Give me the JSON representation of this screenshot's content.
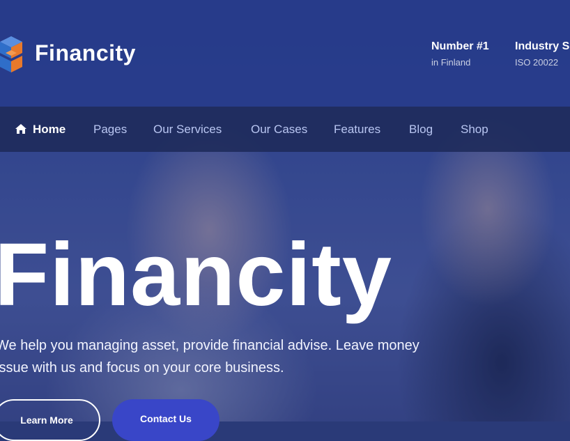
{
  "brand": {
    "name": "Financity",
    "icon": "cube-logo-icon",
    "accent_blue": "#2f6ec9",
    "accent_orange": "#e8792b"
  },
  "header": {
    "info": [
      {
        "title": "Number #1",
        "subtitle": "in Finland"
      },
      {
        "title": "Industry S",
        "subtitle": "ISO 20022"
      }
    ]
  },
  "nav": {
    "items": [
      {
        "label": "Home",
        "icon": "home-icon",
        "active": true
      },
      {
        "label": "Pages"
      },
      {
        "label": "Our Services"
      },
      {
        "label": "Our Cases"
      },
      {
        "label": "Features"
      },
      {
        "label": "Blog"
      },
      {
        "label": "Shop"
      }
    ]
  },
  "hero": {
    "title": "Financity",
    "description": "We help you managing asset, provide financial advise. Leave money issue with us and focus on your core business.",
    "buttons": {
      "learn_more": "Learn More",
      "contact_us": "Contact Us"
    }
  }
}
